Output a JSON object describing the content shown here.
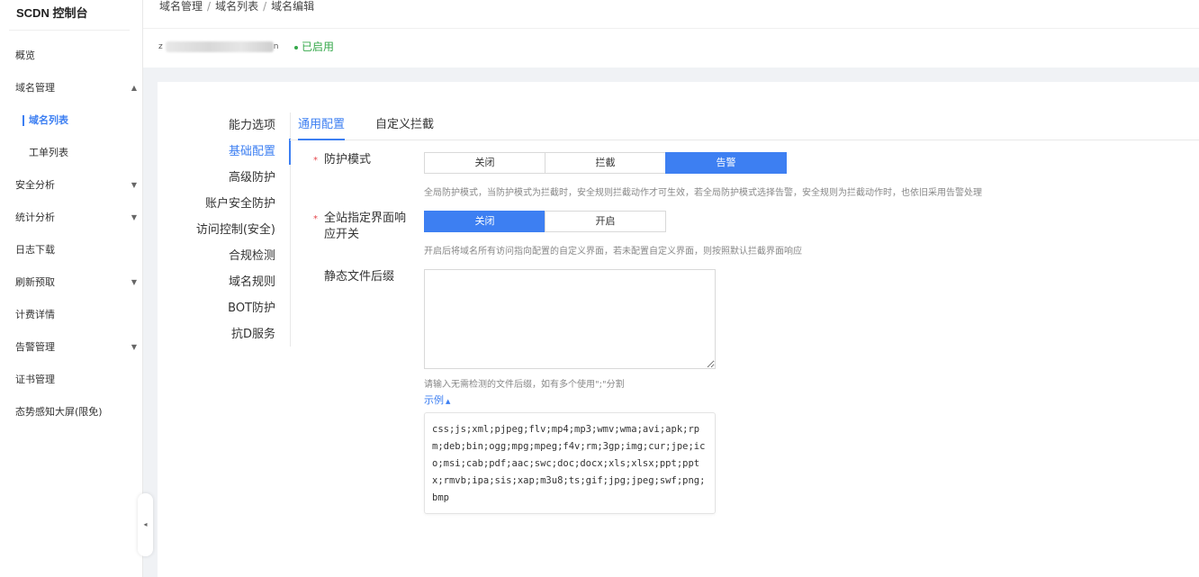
{
  "sidebar": {
    "brand": "SCDN 控制台",
    "items": [
      {
        "label": "概览"
      },
      {
        "label": "域名管理",
        "caret": "▲"
      },
      {
        "label": "域名列表"
      },
      {
        "label": "工单列表"
      },
      {
        "label": "安全分析",
        "caret": "▼"
      },
      {
        "label": "统计分析",
        "caret": "▼"
      },
      {
        "label": "日志下载"
      },
      {
        "label": "刷新预取",
        "caret": "▼"
      },
      {
        "label": "计费详情"
      },
      {
        "label": "告警管理",
        "caret": "▼"
      },
      {
        "label": "证书管理"
      },
      {
        "label": "态势感知大屏(限免)"
      }
    ],
    "collapse_icon": "◂"
  },
  "breadcrumb": [
    "域名管理",
    "域名列表",
    "域名编辑"
  ],
  "breadcrumb_sep": "/",
  "domain": {
    "prefix": "z",
    "suffix": "n",
    "status": "已启用",
    "status_color": "#35a84a"
  },
  "left_menu": [
    "能力选项",
    "基础配置",
    "高级防护",
    "账户安全防护",
    "访问控制(安全)",
    "合规检测",
    "域名规则",
    "BOT防护",
    "抗D服务"
  ],
  "tabs": [
    "通用配置",
    "自定义拦截"
  ],
  "form": {
    "required_mark": "*",
    "protect_mode": {
      "label": "防护模式",
      "options": [
        "关闭",
        "拦截",
        "告警"
      ],
      "selected": "告警",
      "hint": "全局防护模式，当防护模式为拦截时，安全规则拦截动作才可生效，若全局防护模式选择告警，安全规则为拦截动作时，也依旧采用告警处理"
    },
    "page_switch": {
      "label_line1": "全站指定界面响",
      "label_line2": "应开关",
      "options": [
        "关闭",
        "开启"
      ],
      "selected": "关闭",
      "hint": "开启后将域名所有访问指向配置的自定义界面，若未配置自定义界面，则按照默认拦截界面响应"
    },
    "static_suffix": {
      "label": "静态文件后缀",
      "value": "",
      "hint": "请输入无需检测的文件后缀，如有多个使用\";\"分割",
      "example_label": "示例",
      "example_caret": "▲",
      "example_text": "css;js;xml;pjpeg;flv;mp4;mp3;wmv;wma;avi;apk;rpm;deb;bin;ogg;mpg;mpeg;f4v;rm;3gp;img;cur;jpe;ico;msi;cab;pdf;aac;swc;doc;docx;xls;xlsx;ppt;pptx;rmvb;ipa;sis;xap;m3u8;ts;gif;jpg;jpeg;swf;png;bmp"
    }
  },
  "colors": {
    "accent": "#3d7ff2",
    "required": "#e5484d"
  }
}
